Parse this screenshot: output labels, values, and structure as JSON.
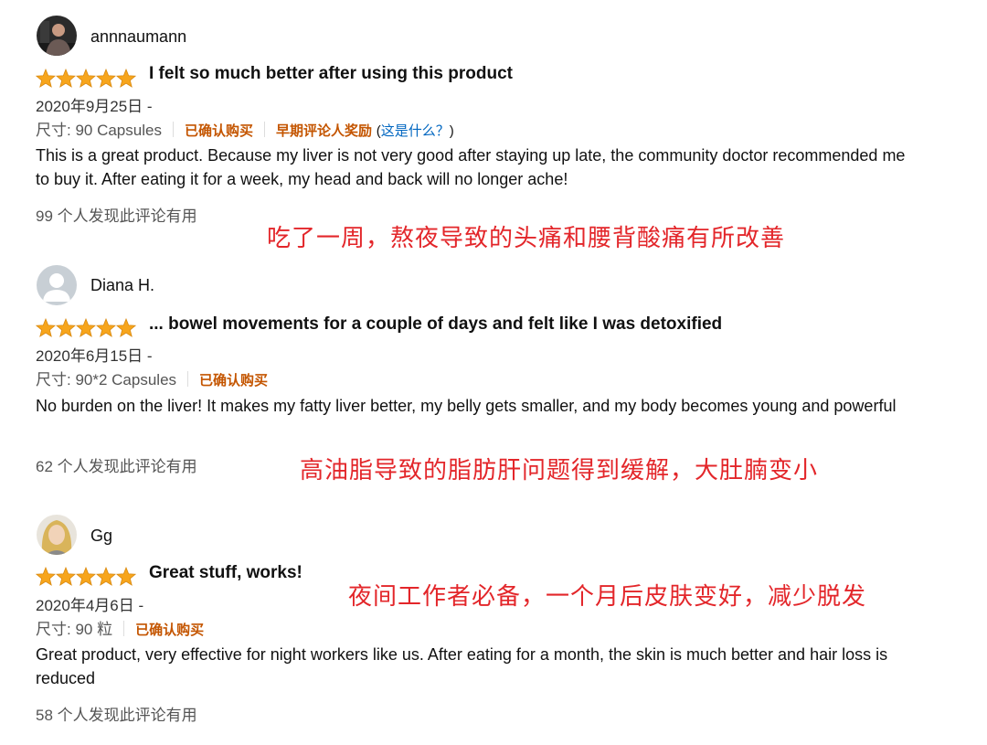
{
  "colors": {
    "star": "#f7a51c",
    "verified": "#c45500",
    "link": "#0066c0",
    "annotation": "#e3262a"
  },
  "rating_max": 5,
  "reviews": [
    {
      "username": "annnaumann",
      "avatar_icon": "user-photo-avatar",
      "rating": 5,
      "title": "I felt so much better after using this product",
      "date": "2020年9月25日 -",
      "size": "尺寸: 90 Capsules",
      "verified": "已确认购买",
      "early_reviewer": "早期评论人奖励",
      "what_is_this_open": "(",
      "what_is_this": "这是什么？",
      "what_is_this_close": ")",
      "body": "This is a great product. Because my liver is not very good after staying up late, the community doctor recommended me to buy it. After eating it for a week, my head and back will no longer ache!",
      "helpful": "99 个人发现此评论有用",
      "annotation": "吃了一周，熬夜导致的头痛和腰背酸痛有所改善"
    },
    {
      "username": "Diana H.",
      "avatar_icon": "default-user-avatar",
      "rating": 5,
      "title": "... bowel movements for a couple of days and felt like I was detoxified",
      "date": "2020年6月15日 -",
      "size": "尺寸: 90*2 Capsules",
      "verified": "已确认购买",
      "body": "No burden on the liver! It makes my fatty liver better, my belly gets smaller, and my body becomes young and powerful",
      "helpful": "62 个人发现此评论有用",
      "annotation": "高油脂导致的脂肪肝问题得到缓解，大肚腩变小"
    },
    {
      "username": "Gg",
      "avatar_icon": "user-photo-avatar",
      "rating": 5,
      "title": "Great stuff, works!",
      "date": "2020年4月6日 -",
      "size": "尺寸: 90 粒",
      "verified": "已确认购买",
      "body": "Great product, very effective for night workers like us. After eating for a month, the skin is much better and hair loss is reduced",
      "helpful": "58 个人发现此评论有用",
      "annotation": "夜间工作者必备，一个月后皮肤变好，减少脱发"
    }
  ]
}
